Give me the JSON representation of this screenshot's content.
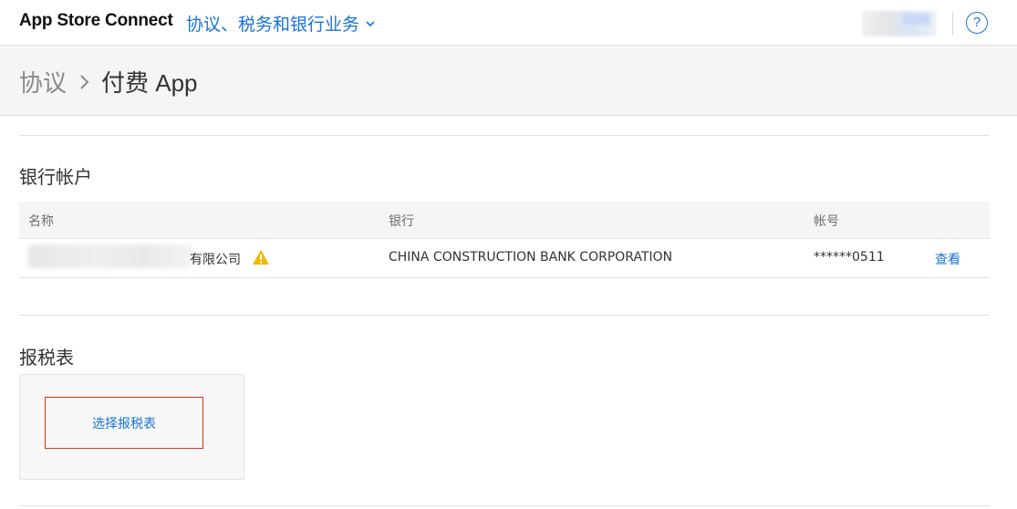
{
  "topbar": {
    "brand": "App Store Connect",
    "section_menu": "协议、税务和银行业务",
    "help": "?"
  },
  "breadcrumb": {
    "parent": "协议",
    "current": "付费 App"
  },
  "bank_accounts": {
    "title": "银行帐户",
    "columns": [
      "名称",
      "银行",
      "帐号"
    ],
    "rows": [
      {
        "name_suffix": "有限公司",
        "bank": "CHINA CONSTRUCTION BANK CORPORATION",
        "account": "******0511",
        "action": "查看"
      }
    ]
  },
  "tax_forms": {
    "title": "报税表",
    "choose_label": "选择报税表"
  },
  "colors": {
    "accent": "#1a73d8",
    "warning": "#f5b800",
    "highlight_border": "#e0301e"
  }
}
